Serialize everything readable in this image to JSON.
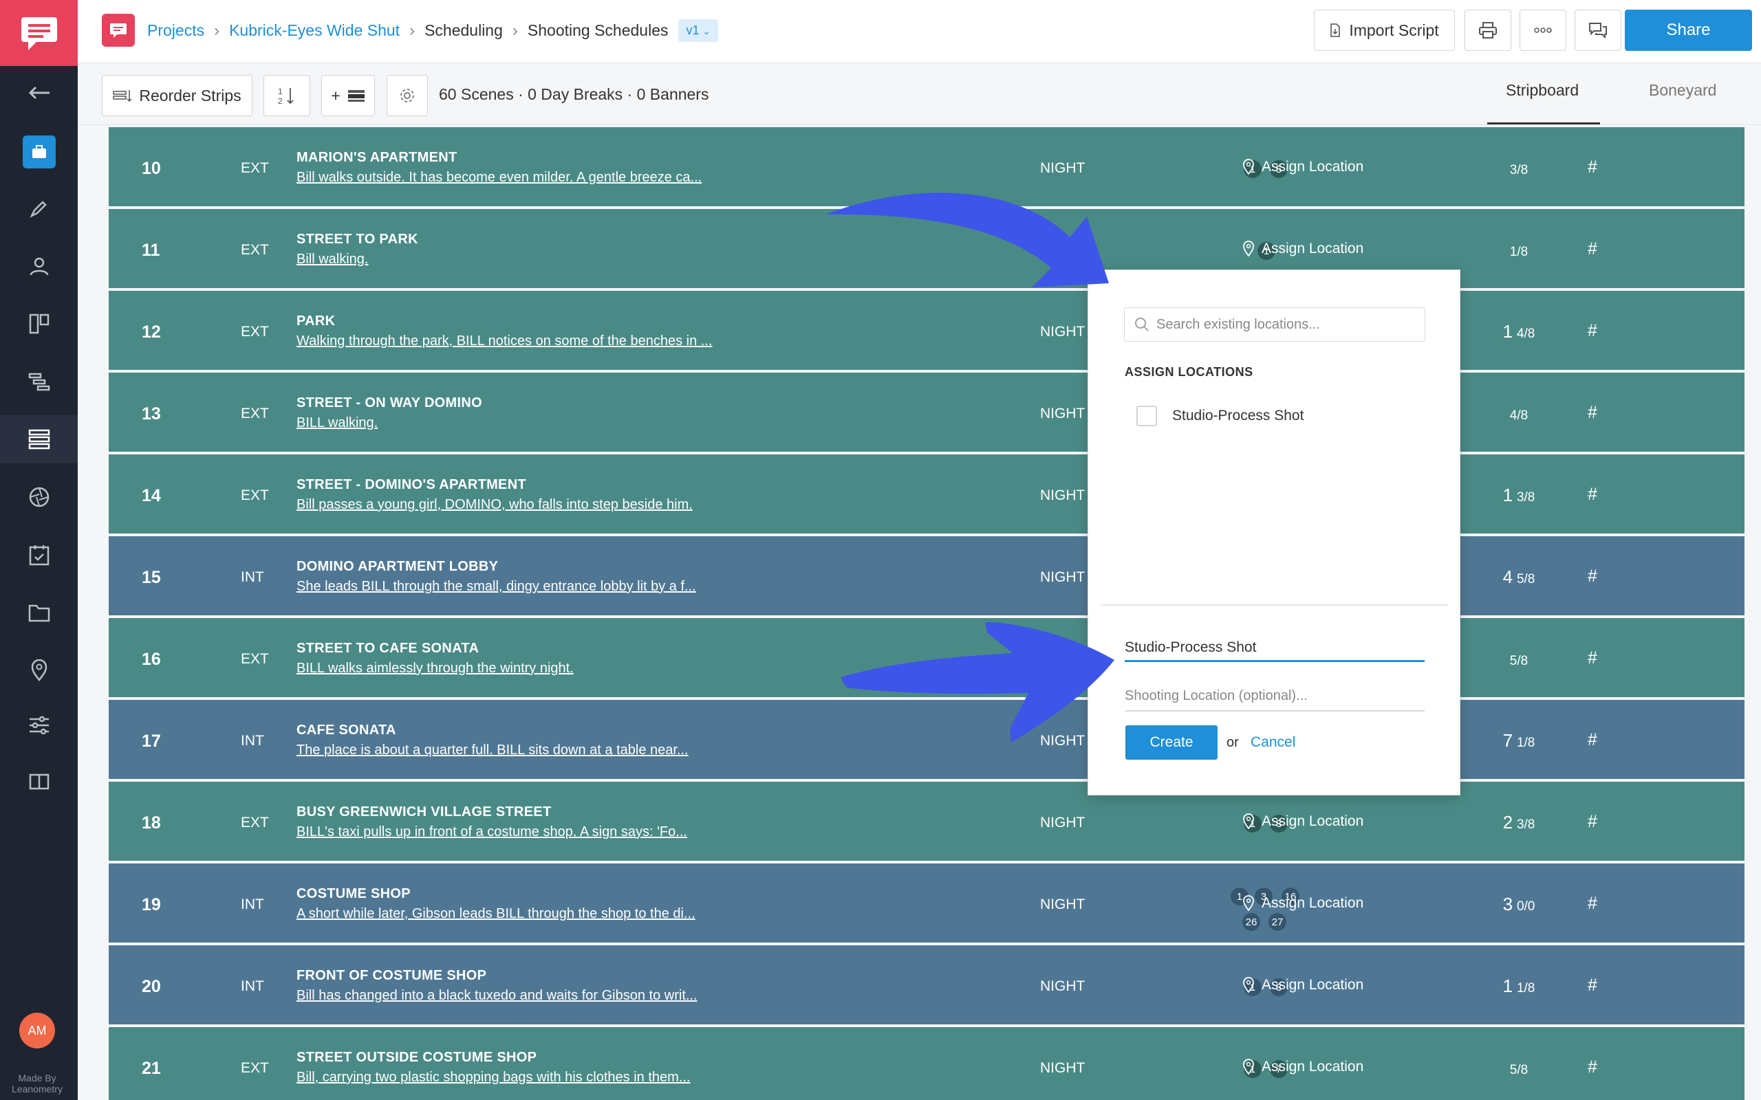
{
  "sidebar": {
    "avatar_initials": "AM",
    "made_by_line1": "Made By",
    "made_by_line2": "Leanometry",
    "icons": [
      "back-arrow-icon",
      "briefcase-icon",
      "pencil-icon",
      "people-icon",
      "board-icon",
      "gantt-icon",
      "stripboard-icon",
      "aperture-icon",
      "calendar-icon",
      "folder-icon",
      "location-pin-icon",
      "sliders-icon",
      "book-icon"
    ]
  },
  "header": {
    "breadcrumb": {
      "projects": "Projects",
      "project": "Kubrick-Eyes Wide Shut",
      "section": "Scheduling",
      "page": "Shooting Schedules",
      "version": "v1"
    },
    "import_label": "Import Script",
    "share_label": "Share"
  },
  "toolbar": {
    "reorder_label": "Reorder Strips",
    "sort_label": "1 2",
    "add_label": "+",
    "summary": "60 Scenes · 0 Day Breaks · 0 Banners",
    "tabs": [
      "Stripboard",
      "Boneyard"
    ]
  },
  "colors": {
    "accent": "#1e8fd8",
    "brand": "#e8415b",
    "ext_strip": "#4a8a86",
    "int_strip": "#4f7793",
    "sidebar": "#1f2431",
    "arrow": "#3d55e8"
  },
  "strips": [
    {
      "num": "10",
      "ie": "EXT",
      "title": "MARION'S APARTMENT",
      "desc": "Bill walks outside. It has become even milder. A gentle breeze ca...",
      "tod": "NIGHT",
      "cast": [
        "1",
        "5"
      ],
      "location": "Assign Location",
      "pages_whole": "",
      "pages_frac": "3/8"
    },
    {
      "num": "11",
      "ie": "EXT",
      "title": "STREET TO PARK",
      "desc": "Bill walking.",
      "tod": "",
      "cast": [
        "1"
      ],
      "location": "Assign Location",
      "pages_whole": "",
      "pages_frac": "1/8"
    },
    {
      "num": "12",
      "ie": "EXT",
      "title": "PARK",
      "desc": "Walking through the park, BILL notices on some of the benches in ...",
      "tod": "NIGHT",
      "cast": [],
      "location": "",
      "pages_whole": "1",
      "pages_frac": "4/8"
    },
    {
      "num": "13",
      "ie": "EXT",
      "title": "STREET - ON WAY DOMINO",
      "desc": "BILL walking.",
      "tod": "NIGHT",
      "cast": [],
      "location": "",
      "pages_whole": "",
      "pages_frac": "4/8"
    },
    {
      "num": "14",
      "ie": "EXT",
      "title": "STREET - DOMINO'S APARTMENT",
      "desc": "Bill passes a young girl, DOMINO, who falls into step beside him.",
      "tod": "NIGHT",
      "cast": [],
      "location": "",
      "pages_whole": "1",
      "pages_frac": "3/8"
    },
    {
      "num": "15",
      "ie": "INT",
      "title": "DOMINO APARTMENT LOBBY",
      "desc": "She leads BILL through the small, dingy entrance lobby lit by a f...",
      "tod": "NIGHT",
      "cast": [],
      "location": "",
      "pages_whole": "4",
      "pages_frac": "5/8"
    },
    {
      "num": "16",
      "ie": "EXT",
      "title": "STREET TO CAFE SONATA",
      "desc": "BILL walks aimlessly through the wintry night.",
      "tod": "",
      "cast": [],
      "location": "",
      "pages_whole": "",
      "pages_frac": "5/8"
    },
    {
      "num": "17",
      "ie": "INT",
      "title": "CAFE SONATA",
      "desc": "The place is about a quarter full. BILL sits down at a table near...",
      "tod": "NIGHT",
      "cast": [],
      "location": "",
      "pages_whole": "7",
      "pages_frac": "1/8"
    },
    {
      "num": "18",
      "ie": "EXT",
      "title": "BUSY GREENWICH VILLAGE STREET",
      "desc": "BILL's taxi pulls up in front of a costume shop. A sign says: 'Fo...",
      "tod": "NIGHT",
      "cast": [
        "1",
        "3"
      ],
      "location": "Assign Location",
      "pages_whole": "2",
      "pages_frac": "3/8"
    },
    {
      "num": "19",
      "ie": "INT",
      "title": "COSTUME SHOP",
      "desc": "A short while later, Gibson leads BILL through the shop to the di...",
      "tod": "NIGHT",
      "cast": [
        "1",
        "3",
        "16",
        "26",
        "27"
      ],
      "location": "Assign Location",
      "pages_whole": "3",
      "pages_frac": "0/0"
    },
    {
      "num": "20",
      "ie": "INT",
      "title": "FRONT OF COSTUME SHOP",
      "desc": "Bill has changed into a black tuxedo and waits for Gibson to writ...",
      "tod": "NIGHT",
      "cast": [
        "1",
        "3"
      ],
      "location": "Assign Location",
      "pages_whole": "1",
      "pages_frac": "1/8"
    },
    {
      "num": "21",
      "ie": "EXT",
      "title": "STREET OUTSIDE COSTUME SHOP",
      "desc": "Bill, carrying two plastic shopping bags with his clothes in them...",
      "tod": "NIGHT",
      "cast": [
        "1",
        "7"
      ],
      "location": "Assign Location",
      "pages_whole": "",
      "pages_frac": "5/8"
    }
  ],
  "strip_hash": "#",
  "popup": {
    "search_placeholder": "Search existing locations...",
    "heading": "ASSIGN LOCATIONS",
    "option_label": "Studio-Process Shot",
    "name_value": "Studio-Process Shot",
    "shooting_placeholder": "Shooting Location (optional)...",
    "create_label": "Create",
    "or_text": "or",
    "cancel_label": "Cancel"
  }
}
